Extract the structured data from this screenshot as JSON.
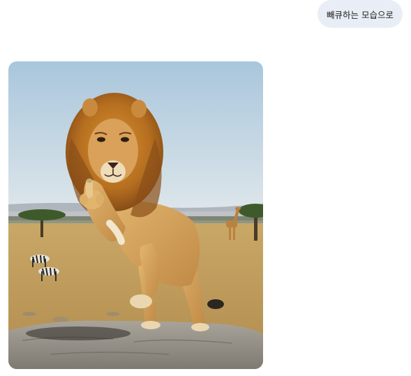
{
  "conversation": {
    "user_message": {
      "text": "빼큐하는 모습으로"
    },
    "response_image": {
      "subject": "lion-raising-middle-finger-on-rock-savanna"
    }
  },
  "colors": {
    "user_bubble_bg": "#e9eef6",
    "page_bg": "#ffffff",
    "text": "#1f1f1f"
  }
}
